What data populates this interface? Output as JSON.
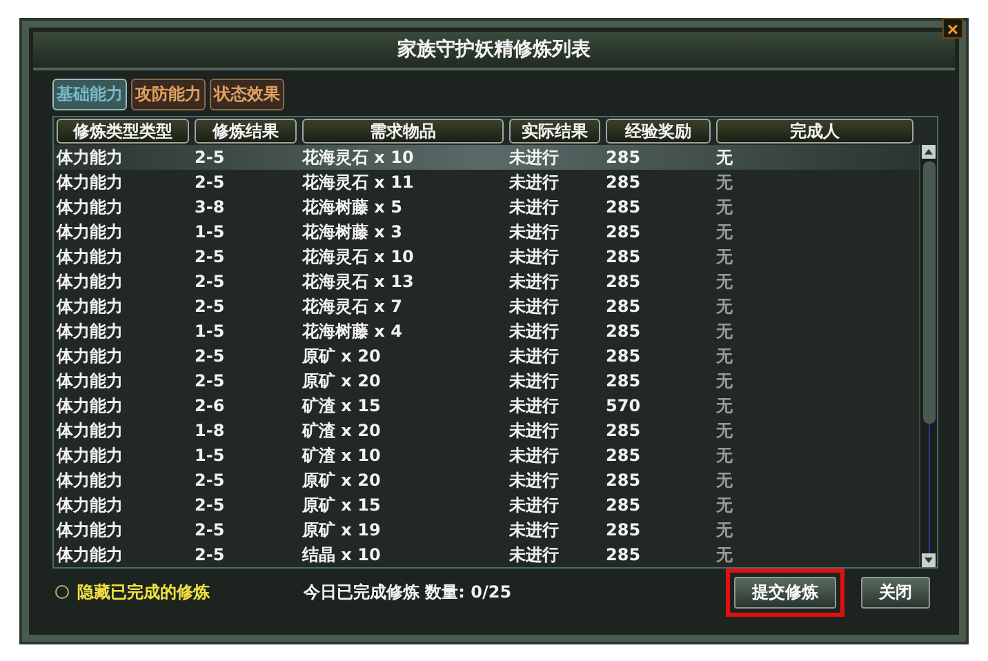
{
  "window": {
    "title": "家族守护妖精修炼列表",
    "close": "×"
  },
  "tabs": [
    {
      "label": "基础能力",
      "selected": true
    },
    {
      "label": "攻防能力",
      "selected": false
    },
    {
      "label": "状态效果",
      "selected": false
    }
  ],
  "table": {
    "columns": [
      "修炼类型类型",
      "修炼结果",
      "需求物品",
      "实际结果",
      "经验奖励",
      "完成人"
    ],
    "rows": [
      {
        "cells": [
          "体力能力",
          "2-5",
          "花海灵石 x 10",
          "未进行",
          "285",
          "无"
        ],
        "selected": true
      },
      {
        "cells": [
          "体力能力",
          "2-5",
          "花海灵石 x 11",
          "未进行",
          "285",
          "无"
        ],
        "selected": false
      },
      {
        "cells": [
          "体力能力",
          "3-8",
          "花海树藤 x 5",
          "未进行",
          "285",
          "无"
        ],
        "selected": false
      },
      {
        "cells": [
          "体力能力",
          "1-5",
          "花海树藤 x 3",
          "未进行",
          "285",
          "无"
        ],
        "selected": false
      },
      {
        "cells": [
          "体力能力",
          "2-5",
          "花海灵石 x 10",
          "未进行",
          "285",
          "无"
        ],
        "selected": false
      },
      {
        "cells": [
          "体力能力",
          "2-5",
          "花海灵石 x 13",
          "未进行",
          "285",
          "无"
        ],
        "selected": false
      },
      {
        "cells": [
          "体力能力",
          "2-5",
          "花海灵石 x 7",
          "未进行",
          "285",
          "无"
        ],
        "selected": false
      },
      {
        "cells": [
          "体力能力",
          "1-5",
          "花海树藤 x 4",
          "未进行",
          "285",
          "无"
        ],
        "selected": false
      },
      {
        "cells": [
          "体力能力",
          "2-5",
          "原矿 x 20",
          "未进行",
          "285",
          "无"
        ],
        "selected": false
      },
      {
        "cells": [
          "体力能力",
          "2-5",
          "原矿 x 20",
          "未进行",
          "285",
          "无"
        ],
        "selected": false
      },
      {
        "cells": [
          "体力能力",
          "2-6",
          "矿渣 x 15",
          "未进行",
          "570",
          "无"
        ],
        "selected": false
      },
      {
        "cells": [
          "体力能力",
          "1-8",
          "矿渣 x 20",
          "未进行",
          "285",
          "无"
        ],
        "selected": false
      },
      {
        "cells": [
          "体力能力",
          "1-5",
          "矿渣 x 10",
          "未进行",
          "285",
          "无"
        ],
        "selected": false
      },
      {
        "cells": [
          "体力能力",
          "2-5",
          "原矿 x 20",
          "未进行",
          "285",
          "无"
        ],
        "selected": false
      },
      {
        "cells": [
          "体力能力",
          "2-5",
          "原矿 x 15",
          "未进行",
          "285",
          "无"
        ],
        "selected": false
      },
      {
        "cells": [
          "体力能力",
          "2-5",
          "原矿 x 19",
          "未进行",
          "285",
          "无"
        ],
        "selected": false
      },
      {
        "cells": [
          "体力能力",
          "2-5",
          "结晶 x 10",
          "未进行",
          "285",
          "无"
        ],
        "selected": false
      }
    ]
  },
  "hide_completed": {
    "label": "隐藏已完成的修炼",
    "checked": false
  },
  "daily_count": "今日已完成修炼 数量: 0/25",
  "buttons": [
    {
      "label": "提交修炼",
      "highlighted": true
    },
    {
      "label": "关闭",
      "highlighted": false
    }
  ]
}
